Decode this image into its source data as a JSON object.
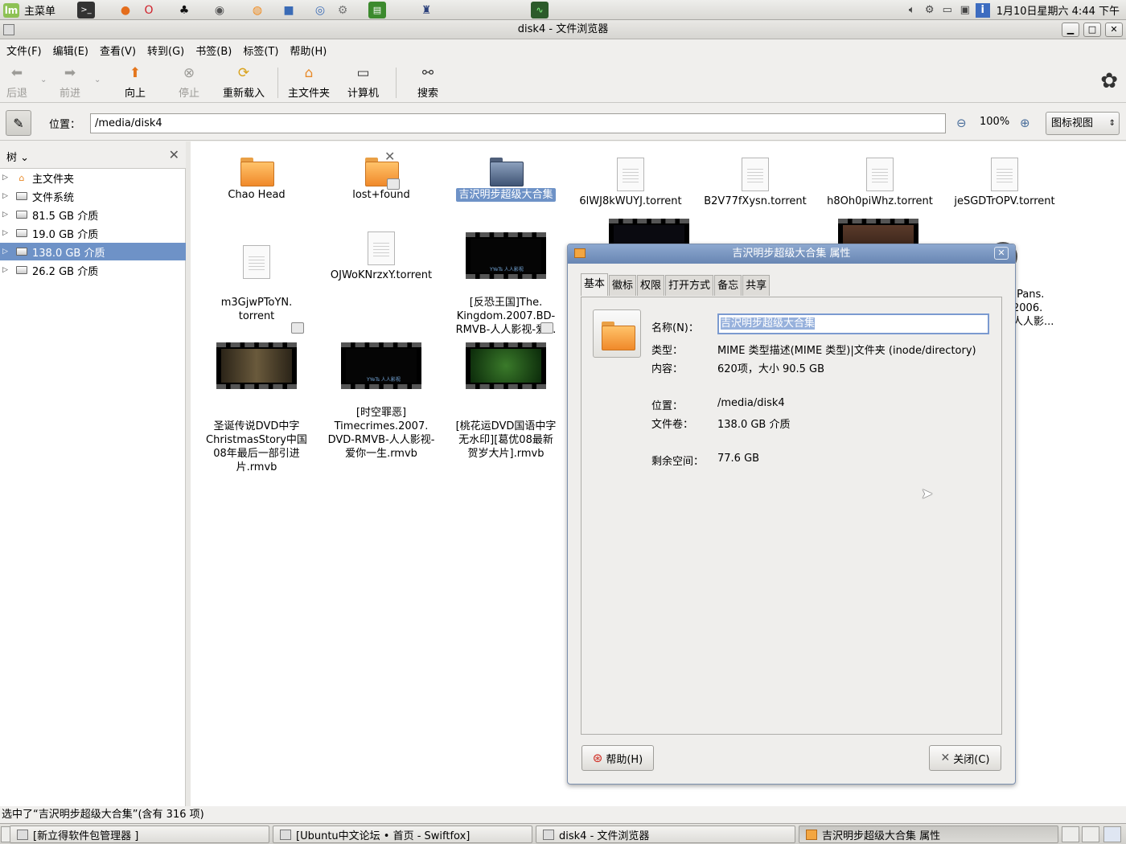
{
  "top_panel": {
    "menu_label": "主菜单",
    "menu_logo": "lm",
    "launchers": [
      "terminal-icon",
      "firefox-icon",
      "opera-icon",
      "qq-icon",
      "disk-utility-icon",
      "burner-icon",
      "package-icon",
      "browser-icon",
      "settings-icon",
      "calculator-icon",
      "wine-icon",
      "system-monitor-icon"
    ],
    "tray_icons": [
      "volume-icon",
      "gear-icon",
      "printer-icon",
      "network-icon",
      "info-icon"
    ],
    "clock": "1月10日星期六  4:44 下午"
  },
  "window": {
    "title": "disk4 - 文件浏览器"
  },
  "menubar": [
    "文件(F)",
    "编辑(E)",
    "查看(V)",
    "转到(G)",
    "书签(B)",
    "标签(T)",
    "帮助(H)"
  ],
  "toolbar": {
    "back": "后退",
    "forward": "前进",
    "up": "向上",
    "stop": "停止",
    "reload": "重新载入",
    "home": "主文件夹",
    "computer": "计算机",
    "search": "搜索"
  },
  "location": {
    "label": "位置：",
    "path": "/media/disk4",
    "zoom": "100%",
    "view_mode": "图标视图"
  },
  "sidebar": {
    "title": "树",
    "items": [
      {
        "label": "主文件夹"
      },
      {
        "label": "文件系统"
      },
      {
        "label": "81.5 GB 介质"
      },
      {
        "label": "19.0 GB 介质"
      },
      {
        "label": "138.0 GB 介质",
        "selected": true
      },
      {
        "label": "26.2 GB 介质"
      }
    ]
  },
  "files": [
    {
      "name": "Chao Head",
      "kind": "folder"
    },
    {
      "name": "lost+found",
      "kind": "folder-locked"
    },
    {
      "name": "吉沢明步超级大合集",
      "kind": "folder-selected"
    },
    {
      "name": "6lWJ8kWUYJ.torrent",
      "kind": "document"
    },
    {
      "name": "B2V77fXysn.torrent",
      "kind": "document"
    },
    {
      "name": "h8Oh0piWhz.torrent",
      "kind": "document"
    },
    {
      "name": "jeSGDTrOPV.torrent",
      "kind": "document"
    },
    {
      "name": "m3GjwPToYN.\ntorrent",
      "kind": "document"
    },
    {
      "name": "OJWoKNrzxY.torrent",
      "kind": "document"
    },
    {
      "name": "[反恐王国]The.\nKingdom.2007.BD-\nRMVB-人人影视-爱...",
      "kind": "video"
    },
    {
      "name": "]Pans.\n2006.\n人人影...",
      "kind": "video-partial"
    },
    {
      "name": "圣诞传说DVD中字\nChristmasStory中国\n08年最后一部引进\n片.rmvb",
      "kind": "video"
    },
    {
      "name": "[时空罪恶]\nTimecrimes.2007.\nDVD-RMVB-人人影视-\n爱你一生.rmvb",
      "kind": "video"
    },
    {
      "name": "[桃花运DVD国语中字\n无水印][葛优08最新\n贺岁大片].rmvb",
      "kind": "video"
    }
  ],
  "dialog": {
    "title": "吉沢明步超级大合集 属性",
    "tabs": [
      "基本",
      "徽标",
      "权限",
      "打开方式",
      "备忘",
      "共享"
    ],
    "name_label": "名称(N)：",
    "name_value": "吉沢明步超级大合集",
    "type_label": "类型：",
    "type_value": "MIME 类型描述(MIME 类型)|文件夹 (inode/directory)",
    "contents_label": "内容：",
    "contents_value": "620项，大小 90.5 GB",
    "location_label": "位置：",
    "location_value": "/media/disk4",
    "volume_label": "文件卷：",
    "volume_value": "138.0 GB 介质",
    "free_label": "剩余空间：",
    "free_value": "77.6 GB",
    "help_button": "帮助(H)",
    "close_button": "关闭(C)"
  },
  "statusbar": "选中了“吉沢明步超级大合集”(含有 316 项)",
  "taskbar": [
    {
      "label": "[新立得软件包管理器 ]"
    },
    {
      "label": "[Ubuntu中文论坛 • 首页 - Swiftfox]"
    },
    {
      "label": "disk4 - 文件浏览器"
    },
    {
      "label": "吉沢明步超级大合集 属性",
      "active": true
    }
  ]
}
